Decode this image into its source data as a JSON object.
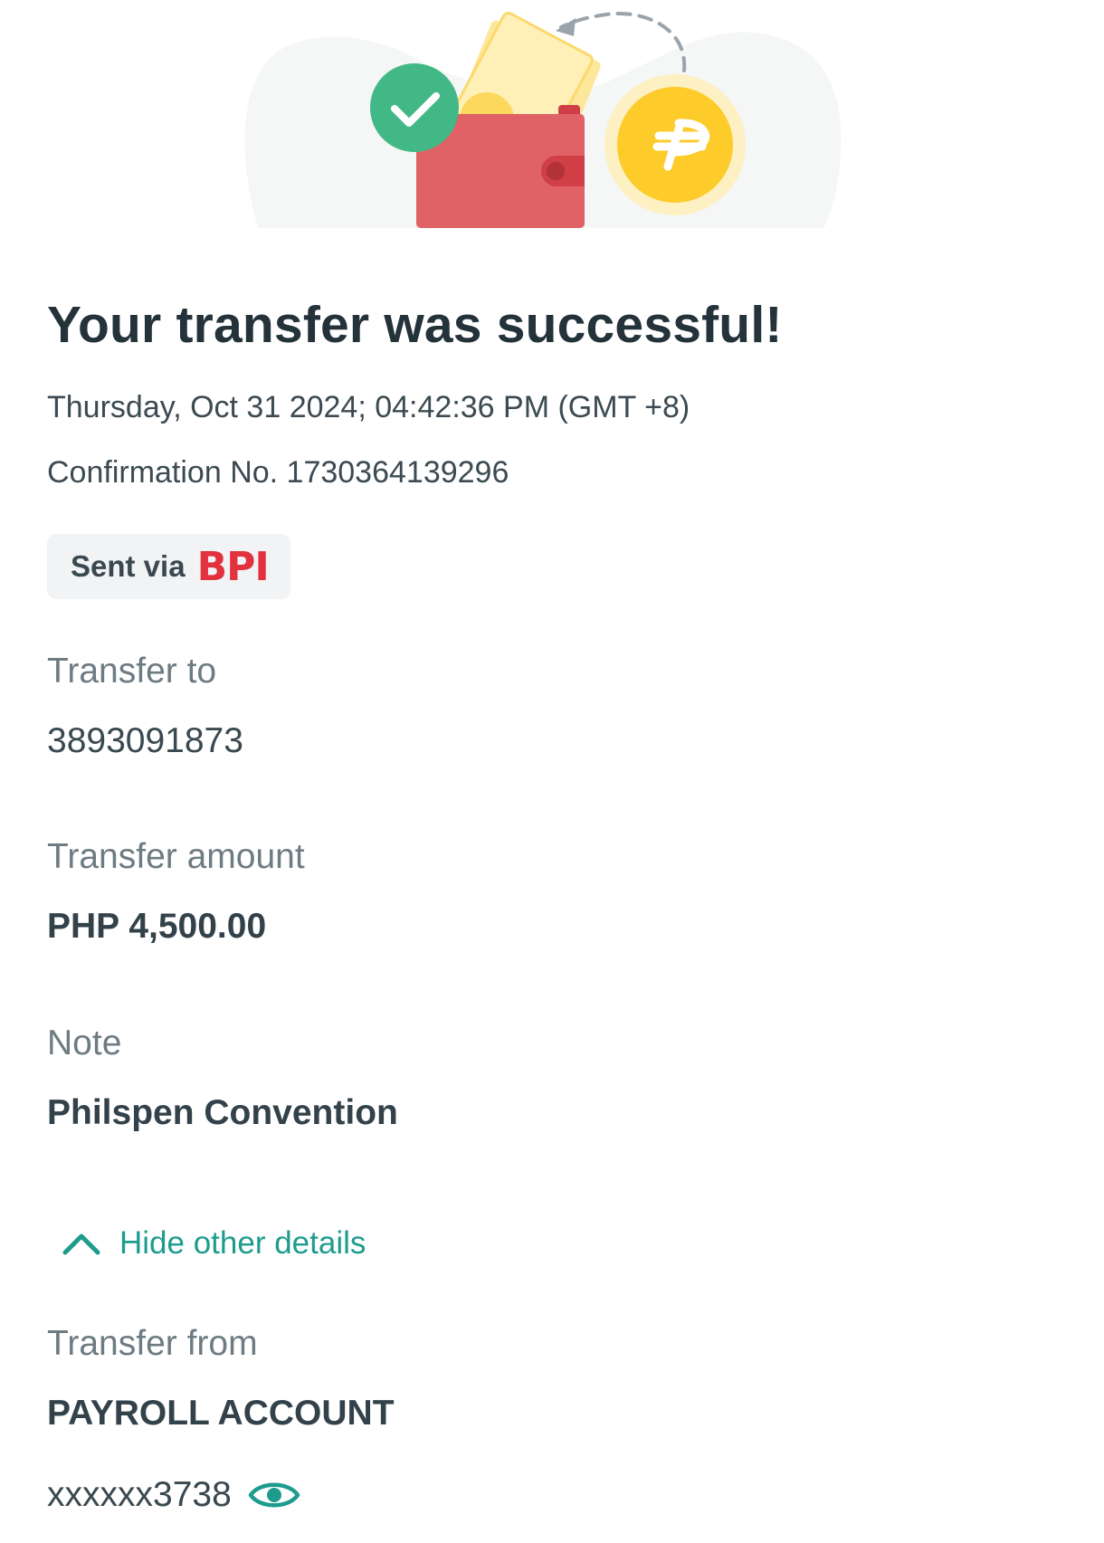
{
  "header": {
    "title": "Your transfer was successful!",
    "datetime": "Thursday, Oct 31 2024; 04:42:36 PM (GMT +8)",
    "confirmation": "Confirmation No. 1730364139296"
  },
  "sent_via": {
    "label": "Sent via",
    "bank": "BPI"
  },
  "transfer_to": {
    "label": "Transfer to",
    "value": "3893091873"
  },
  "transfer_amount": {
    "label": "Transfer amount",
    "value": "PHP 4,500.00"
  },
  "note": {
    "label": "Note",
    "value": "Philspen Convention"
  },
  "details_toggle": {
    "label": "Hide other details",
    "icon": "chevron-up-icon"
  },
  "transfer_from": {
    "label": "Transfer from",
    "account_name": "PAYROLL ACCOUNT",
    "account_number": "xxxxxx3738",
    "reveal_icon": "eye-icon"
  },
  "colors": {
    "accent_teal": "#1d9c8e",
    "success_green": "#43b887",
    "bank_red": "#e2323e",
    "wallet_red": "#e06266",
    "coin_yellow": "#fdcb2a",
    "chip_bg": "#f1f3f4"
  },
  "illustration": {
    "icons": [
      "success-check-icon",
      "wallet-icon",
      "banknote-icon",
      "peso-coin-icon",
      "transfer-arrow-icon"
    ]
  }
}
